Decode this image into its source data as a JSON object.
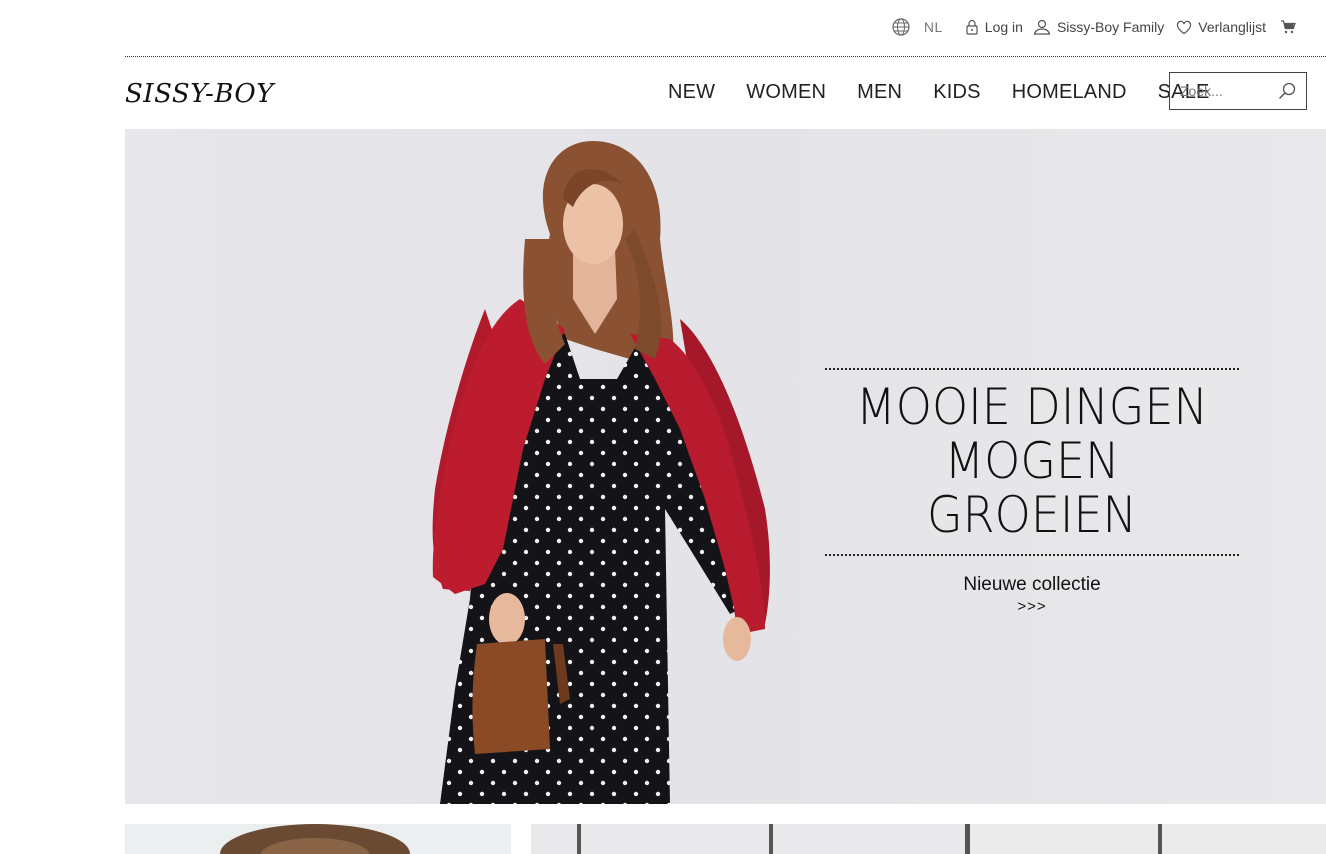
{
  "topbar": {
    "lang": "NL",
    "login": "Log in",
    "family": "Sissy-Boy Family",
    "wishlist": "Verlanglijst"
  },
  "logo": "SISSY-BOY",
  "nav": [
    "NEW",
    "WOMEN",
    "MEN",
    "KIDS",
    "HOMELAND",
    "SALE"
  ],
  "search": {
    "placeholder": "Zoek..."
  },
  "hero": {
    "headline_1": "MOOIE DINGEN",
    "headline_2": "MOGEN GROEIEN",
    "cta": "Nieuwe collectie",
    "cta_arrow": ">>>"
  },
  "colors": {
    "jacket": "#b01a2a",
    "dress": "#141418",
    "hero_bg": "#e6e5e9"
  }
}
